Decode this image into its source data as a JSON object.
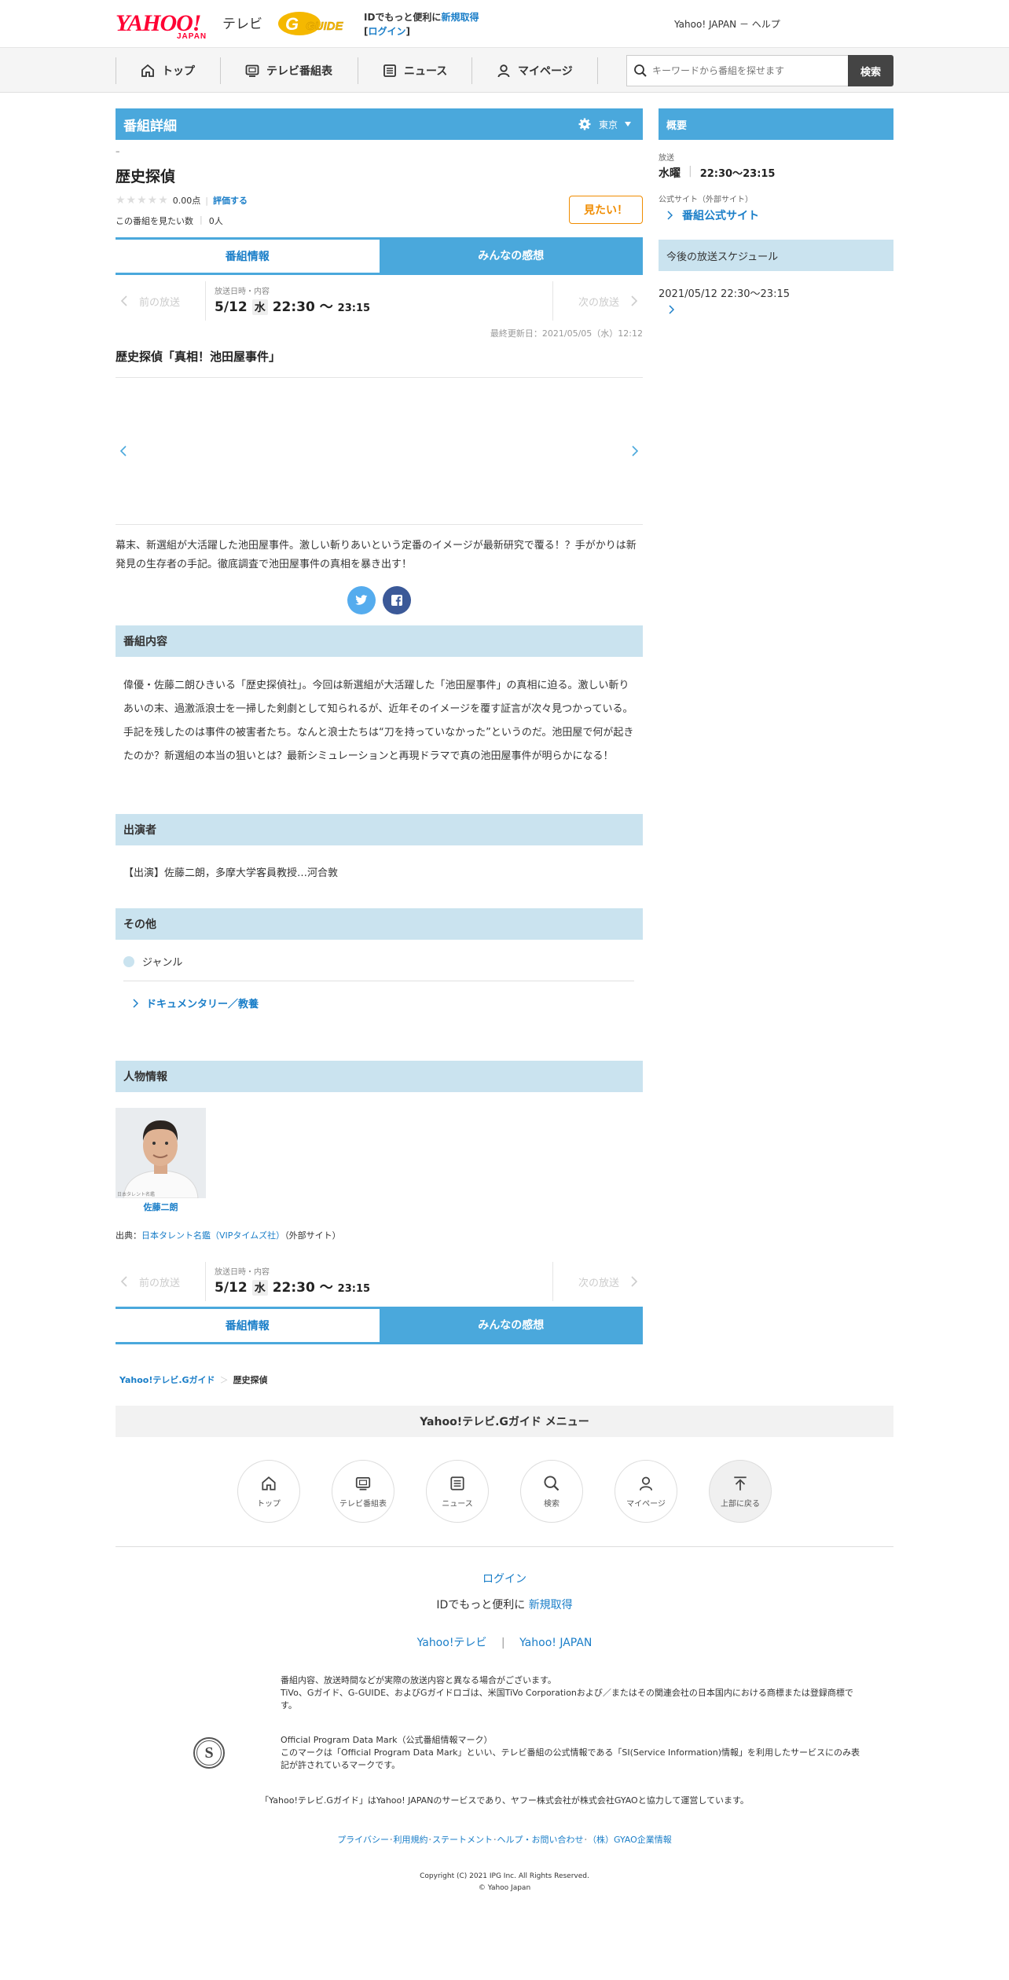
{
  "header": {
    "logo_yahoo": "YAHOO!",
    "logo_japan": "JAPAN",
    "logo_tv": "テレビ",
    "logo_gguide": "G GUIDE",
    "id_text": "IDでもっと便利に",
    "signup": "新規取得",
    "login": "ログイン",
    "bracket_open": "[",
    "bracket_close": "]",
    "right_links": "Yahoo! JAPAN － ヘルプ"
  },
  "nav": {
    "items": [
      {
        "label": "トップ",
        "icon": "home-icon"
      },
      {
        "label": "テレビ番組表",
        "icon": "tv-icon"
      },
      {
        "label": "ニュース",
        "icon": "news-icon"
      },
      {
        "label": "マイページ",
        "icon": "user-icon"
      }
    ],
    "search_placeholder": "キーワードから番組を探せます",
    "search_button": "検索"
  },
  "program": {
    "section_title": "番組詳細",
    "region": "東京",
    "dash": "–",
    "title": "歴史探偵",
    "score": "0.00点",
    "rate_link": "評価する",
    "want_label": "この番組を見たい数",
    "want_count": "0人",
    "want_button": "見たい！",
    "tabs": [
      "番組情報",
      "みんなの感想"
    ],
    "prev": "前の放送",
    "next": "次の放送",
    "broadcast_label": "放送日時・内容",
    "date": "5/12",
    "weekday": "水",
    "start": "22:30",
    "tilde": "〜",
    "end": "23:15",
    "updated": "最終更新日：2021/05/05（水）12:12",
    "episode_title": "歴史探偵「真相！池田屋事件」",
    "summary": "幕末、新選組が大活躍した池田屋事件。激しい斬りあいという定番のイメージが最新研究で覆る！？手がかりは新発見の生存者の手記。徹底調査で池田屋事件の真相を暴き出す！",
    "content_title": "番組内容",
    "content": "偉優・佐藤二朗ひきいる「歴史探偵社」。今回は新選組が大活躍した「池田屋事件」の真相に迫る。激しい斬りあいの末、過激派浪士を一掃した剣劇として知られるが、近年そのイメージを覆す証言が次々見つかっている。手記を残したのは事件の被害者たち。なんと浪士たちは“刀を持っていなかった”というのだ。池田屋で何が起きたのか？新選組の本当の狙いとは？最新シミュレーションと再現ドラマで真の池田屋事件が明らかになる！",
    "cast_title": "出演者",
    "cast": "【出演】佐藤二朗，多摩大学客員教授…河合敦",
    "other_title": "その他",
    "genre_label": "ジャンル",
    "genre": "ドキュメンタリー／教養",
    "people_title": "人物情報",
    "person_name": "佐藤二朗",
    "photo_credit": "日本タレント名鑑",
    "source_prefix": "出典：",
    "source_link": "日本タレント名鑑（VIPタイムズ社）",
    "source_suffix": "（外部サイト）"
  },
  "breadcrumb": {
    "root": "Yahoo!テレビ.Gガイド",
    "sep": "＞",
    "current": "歴史探偵"
  },
  "sidebar": {
    "overview_title": "概要",
    "broadcast_label": "放送",
    "weekday": "水曜",
    "time": "22:30～23:15",
    "official_label": "公式サイト（外部サイト）",
    "official_link": "番組公式サイト",
    "schedule_title": "今後の放送スケジュール",
    "schedule_item": "2021/05/12 22:30～23:15"
  },
  "footer": {
    "menu_title": "Yahoo!テレビ.Gガイド メニュー",
    "icons": [
      {
        "label": "トップ",
        "icon": "home-icon"
      },
      {
        "label": "テレビ番組表",
        "icon": "tv-icon"
      },
      {
        "label": "ニュース",
        "icon": "news-icon"
      },
      {
        "label": "検索",
        "icon": "search-icon"
      },
      {
        "label": "マイページ",
        "icon": "user-icon"
      },
      {
        "label": "上部に戻る",
        "icon": "arrow-up-icon"
      }
    ],
    "login": "ログイン",
    "id_text": "IDでもっと便利に",
    "signup": "新規取得",
    "link_tv": "Yahoo!テレビ",
    "link_sep": "|",
    "link_japan": "Yahoo! JAPAN",
    "notice1": "番組内容、放送時間などが実際の放送内容と異なる場合がございます。",
    "notice2": "TiVo、Gガイド、G-GUIDE、およびGガイドロゴは、米国TiVo Corporationおよび／またはその関連会社の日本国内における商標または登録商標です。",
    "opdm_title": "Official Program Data Mark（公式番組情報マーク）",
    "opdm_text": "このマークは「Official Program Data Mark」といい、テレビ番組の公式情報である「SI(Service Information)情報」を利用したサービスにのみ表記が許されているマークです。",
    "opdm_mark": "S",
    "operation": "「Yahoo!テレビ.Gガイド」はYahoo! JAPANのサービスであり、ヤフー株式会社が株式会社GYAOと協力して運営しています。",
    "bottom_links": [
      {
        "label": "プライバシー"
      },
      {
        "label": "利用規約"
      },
      {
        "label": "ステートメント"
      },
      {
        "label": "ヘルプ・お問い合わせ"
      },
      {
        "label": "（株）GYAO企業情報"
      }
    ],
    "link_dot": "･",
    "copyright1": "Copyright (C) 2021 IPG Inc. All Rights Reserved.",
    "copyright2": "© Yahoo Japan"
  },
  "colors": {
    "accent": "#4aa8dc",
    "light_bar": "#cae3ef",
    "link": "#1a7ec8",
    "want_orange": "#f08c00",
    "yahoo_red": "#ff0033",
    "gguide_yellow": "#f5b800"
  }
}
